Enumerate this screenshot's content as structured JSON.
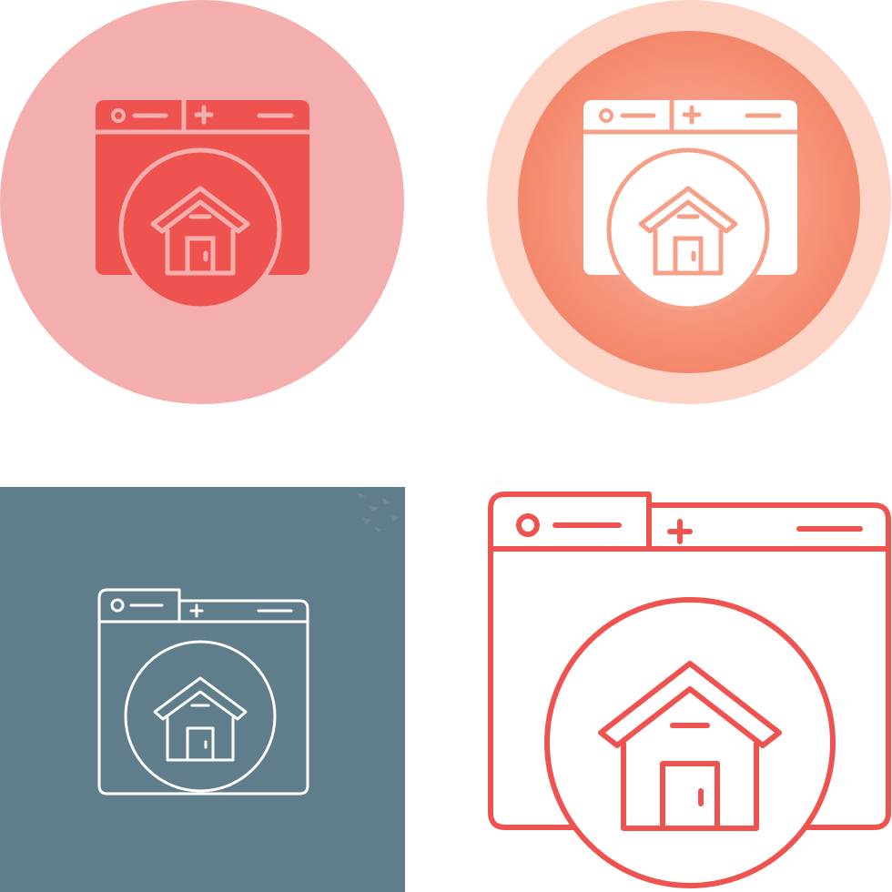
{
  "icon_set": {
    "variants": [
      {
        "style": "glyph-circle",
        "icon": "browser-home-icon",
        "background": "#f5aeae",
        "fill": "#ef5350",
        "line": "#f5aeae"
      },
      {
        "style": "glyph-gradient-circle",
        "icon": "browser-home-icon",
        "background_outer": "#fdd3c6",
        "background_inner_start": "#fbb39e",
        "background_inner_end": "#f4866a",
        "fill": "#ffffff",
        "line": "#f5a48c"
      },
      {
        "style": "line-square",
        "icon": "browser-home-icon",
        "background": "#607d8b",
        "line": "#ffffff"
      },
      {
        "style": "line-plain",
        "icon": "browser-home-icon",
        "line": "#ef5350"
      }
    ]
  }
}
